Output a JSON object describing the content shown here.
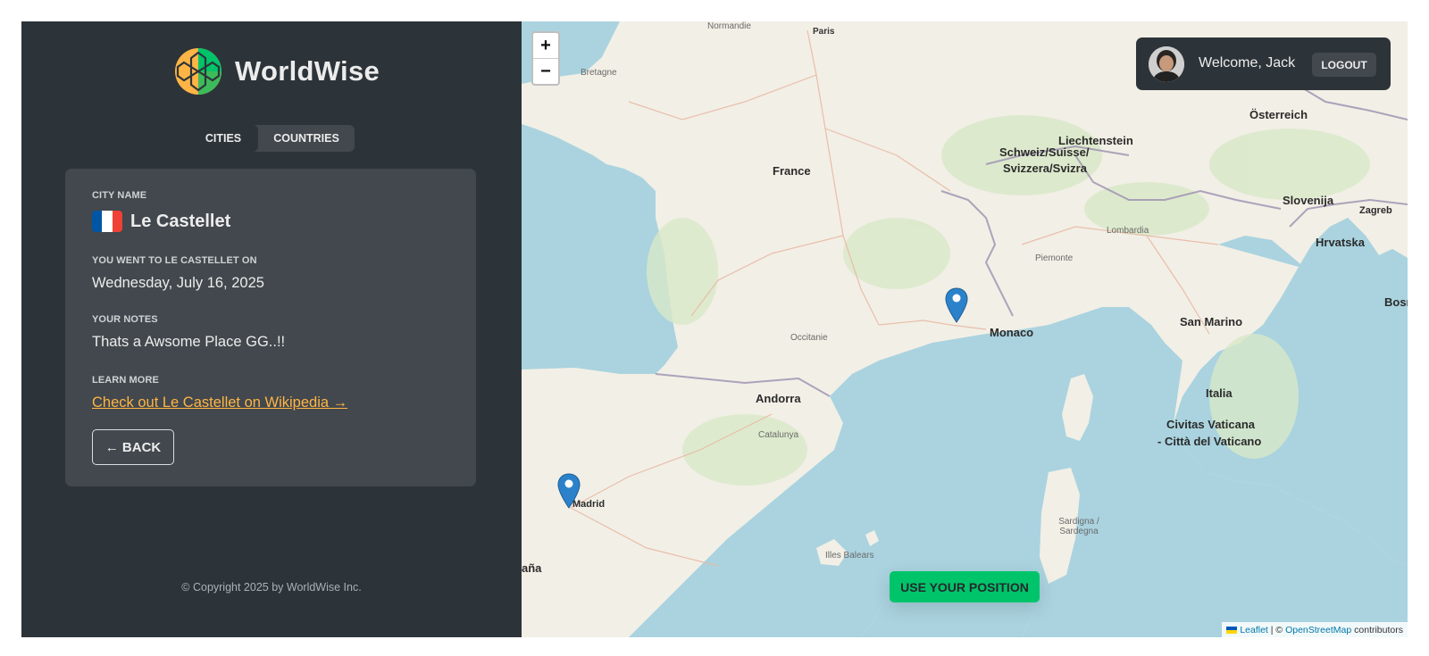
{
  "brand": {
    "name": "WorldWise"
  },
  "tabs": [
    {
      "label": "CITIES",
      "active": true
    },
    {
      "label": "COUNTRIES",
      "active": false
    }
  ],
  "city": {
    "name_label": "CITY NAME",
    "name": "Le Castellet",
    "flag_icon": "france-flag-icon",
    "date_label": "YOU WENT TO LE CASTELLET ON",
    "date": "Wednesday, July 16, 2025",
    "notes_label": "YOUR NOTES",
    "notes": "Thats a Awsome Place GG..!!",
    "learn_label": "LEARN MORE",
    "wiki_link": "Check out Le Castellet on Wikipedia →",
    "back_label": "← BACK"
  },
  "footer": {
    "copyright": "© Copyright 2025 by WorldWise Inc."
  },
  "user": {
    "welcome": "Welcome, Jack",
    "logout_label": "LOGOUT"
  },
  "map": {
    "zoom_in": "+",
    "zoom_out": "−",
    "use_position_label": "USE YOUR POSITION",
    "attribution": {
      "leaflet": "Leaflet",
      "sep": " | © ",
      "osm": "OpenStreetMap",
      "tail": " contributors"
    },
    "labels": {
      "paris": "Paris",
      "france": "France",
      "andorra": "Andorra",
      "monaco": "Monaco",
      "madrid": "Madrid",
      "liechtenstein": "Liechtenstein",
      "switzerland1": "Schweiz/Suisse/",
      "switzerland2": "Svizzera/Svizra",
      "austria": "Österreich",
      "slovenia": "Slovenija",
      "croatia": "Hrvatska",
      "zagreb": "Zagreb",
      "bosnia": "Bosna",
      "sanmarino": "San Marino",
      "italia": "Italia",
      "vatican1": "Civitas Vaticana",
      "vatican2": "- Città del Vaticano",
      "espana": "aña",
      "bretagne": "Bretagne",
      "normandie": "Normandie",
      "occitanie": "Occitanie",
      "catalunya": "Catalunya",
      "sardegna": "Sardigna / Sardegna",
      "illes": "Illes Balears",
      "lombardia": "Lombardia",
      "piemonte": "Piemonte"
    },
    "pins": [
      {
        "name": "Le Castellet"
      },
      {
        "name": "Madrid"
      }
    ]
  },
  "colors": {
    "sidebar": "#2d3439",
    "card": "#42484d",
    "accent": "#00c46a",
    "link": "#ffb545",
    "sea": "#aad3df"
  }
}
